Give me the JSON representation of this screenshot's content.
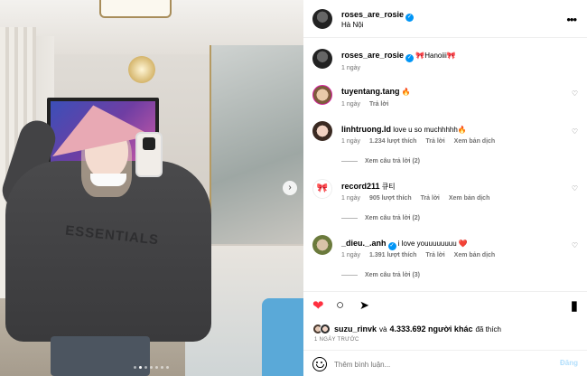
{
  "photo": {
    "sweater_text": "ESSENTIALS",
    "next_icon": "›",
    "carousel_dots": 7,
    "carousel_active": 1
  },
  "header": {
    "username": "roses_are_rosie",
    "verified_icon": "✓",
    "location": "Hà Nội",
    "more_icon": "•••"
  },
  "caption": {
    "username": "roses_are_rosie",
    "text": "🎀Hanoiii🎀",
    "age": "1 ngày"
  },
  "comments": [
    {
      "username": "tuyentang.tang",
      "text": "🔥",
      "age": "1 ngày",
      "likes": "",
      "reply": "Trả lời",
      "translate": "",
      "view_replies": ""
    },
    {
      "username": "linhtruong.ld",
      "text": "love u so muchhhhh🔥",
      "age": "1 ngày",
      "likes": "1.234 lượt thích",
      "reply": "Trả lời",
      "translate": "Xem bản dịch",
      "view_replies": "Xem câu trả lời (2)"
    },
    {
      "username": "record211",
      "text": "큐티",
      "age": "1 ngày",
      "likes": "905 lượt thích",
      "reply": "Trả lời",
      "translate": "Xem bản dịch",
      "view_replies": "Xem câu trả lời (2)"
    },
    {
      "username": "_dieu._.anh",
      "text": "i love youuuuuuuu ❤️",
      "age": "1 ngày",
      "likes": "1.391 lượt thích",
      "reply": "Trả lời",
      "translate": "Xem bản dịch",
      "view_replies": "Xem câu trả lời (3)"
    }
  ],
  "actions": {
    "like_icon": "❤",
    "comment_icon": "○",
    "share_icon": "➤",
    "save_icon": "▮"
  },
  "likes": {
    "user": "suzu_rinvk",
    "connector": "và",
    "count_text": "4.333.692 người khác",
    "suffix": "đã thích"
  },
  "timestamp": "1 NGÀY TRƯỚC",
  "comment_box": {
    "placeholder": "Thêm bình luận...",
    "post_label": "Đăng"
  },
  "colors": {
    "like_red": "#ff3040",
    "verified_blue": "#0095f6",
    "post_disabled": "#b2dffc",
    "meta_gray": "#737373"
  }
}
